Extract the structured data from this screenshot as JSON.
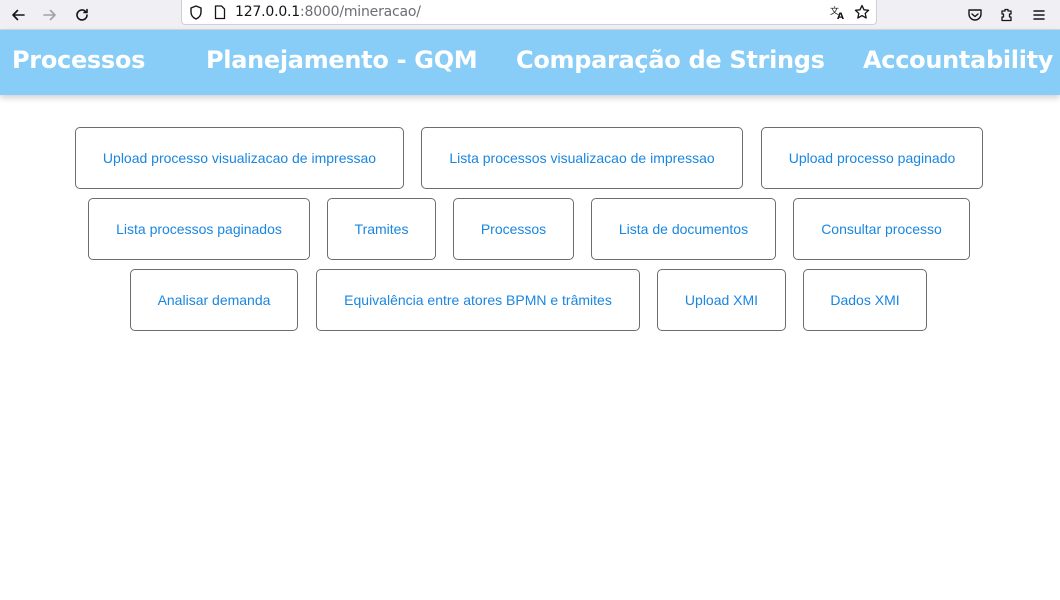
{
  "browser": {
    "url_host": "127.0.0.1",
    "url_rest": ":8000/mineracao/",
    "icons": [
      "back-icon",
      "forward-icon",
      "reload-icon",
      "shield-icon",
      "page-icon",
      "translate-icon",
      "star-icon",
      "pocket-icon",
      "extensions-icon",
      "menu-icon"
    ]
  },
  "navbar": {
    "color": "#87cdf7",
    "links": [
      "Processos",
      "Planejamento - GQM",
      "Comparação de Strings",
      "Accountability"
    ]
  },
  "buttons": {
    "link_color": "#1a86e0",
    "row1": [
      "Upload processo visualizacao de impressao",
      "Lista processos visualizacao de impressao",
      "Upload processo paginado"
    ],
    "row2": [
      "Lista processos paginados",
      "Tramites",
      "Processos",
      "Lista de documentos",
      "Consultar processo"
    ],
    "row3": [
      "Analisar demanda",
      "Equivalência entre atores BPMN e trâmites",
      "Upload XMI",
      "Dados XMI"
    ]
  }
}
